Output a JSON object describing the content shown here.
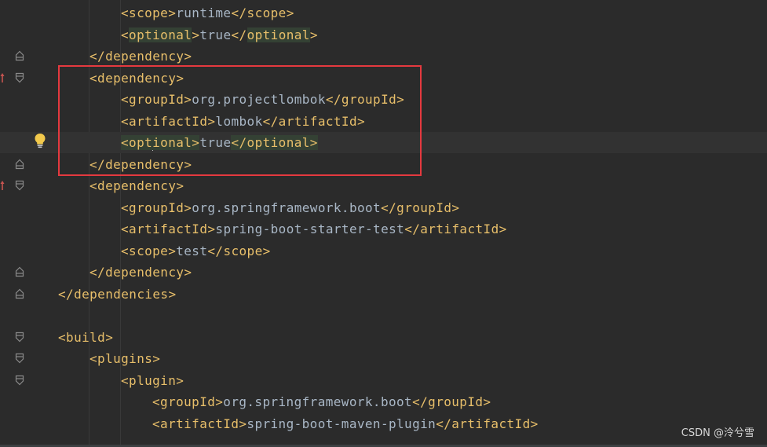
{
  "editor": {
    "lines": [
      {
        "indent": 2,
        "parts": [
          {
            "k": "tag",
            "t": "<scope>"
          },
          {
            "k": "txt",
            "t": "runtime"
          },
          {
            "k": "tag",
            "t": "</scope>"
          }
        ]
      },
      {
        "indent": 2,
        "parts": [
          {
            "k": "tag",
            "t": "<"
          },
          {
            "k": "tag-hl",
            "t": "optional"
          },
          {
            "k": "tag",
            "t": ">"
          },
          {
            "k": "txt",
            "t": "true"
          },
          {
            "k": "tag",
            "t": "</"
          },
          {
            "k": "tag-hl",
            "t": "optional"
          },
          {
            "k": "tag",
            "t": ">"
          }
        ]
      },
      {
        "indent": 1,
        "parts": [
          {
            "k": "tag",
            "t": "</dependency>"
          }
        ]
      },
      {
        "indent": 1,
        "parts": [
          {
            "k": "tag",
            "t": "<dependency>"
          }
        ]
      },
      {
        "indent": 2,
        "parts": [
          {
            "k": "tag",
            "t": "<groupId>"
          },
          {
            "k": "txt",
            "t": "org.projectlombok"
          },
          {
            "k": "tag",
            "t": "</groupId>"
          }
        ]
      },
      {
        "indent": 2,
        "parts": [
          {
            "k": "tag",
            "t": "<artifactId>"
          },
          {
            "k": "txt",
            "t": "lombok"
          },
          {
            "k": "tag",
            "t": "</artifactId>"
          }
        ]
      },
      {
        "indent": 2,
        "current": true,
        "parts": [
          {
            "k": "tag-hl",
            "t": "<opt"
          },
          {
            "k": "caret",
            "t": ""
          },
          {
            "k": "tag-hl",
            "t": "ional>"
          },
          {
            "k": "txt",
            "t": "true"
          },
          {
            "k": "tag-hl",
            "t": "</optional>"
          }
        ]
      },
      {
        "indent": 1,
        "parts": [
          {
            "k": "tag",
            "t": "</dependency>"
          }
        ]
      },
      {
        "indent": 1,
        "parts": [
          {
            "k": "tag",
            "t": "<dependency>"
          }
        ]
      },
      {
        "indent": 2,
        "parts": [
          {
            "k": "tag",
            "t": "<groupId>"
          },
          {
            "k": "txt",
            "t": "org.springframework.boot"
          },
          {
            "k": "tag",
            "t": "</groupId>"
          }
        ]
      },
      {
        "indent": 2,
        "parts": [
          {
            "k": "tag",
            "t": "<artifactId>"
          },
          {
            "k": "txt",
            "t": "spring-boot-starter-test"
          },
          {
            "k": "tag",
            "t": "</artifactId>"
          }
        ]
      },
      {
        "indent": 2,
        "parts": [
          {
            "k": "tag",
            "t": "<scope>"
          },
          {
            "k": "txt",
            "t": "test"
          },
          {
            "k": "tag",
            "t": "</scope>"
          }
        ]
      },
      {
        "indent": 1,
        "parts": [
          {
            "k": "tag",
            "t": "</dependency>"
          }
        ]
      },
      {
        "indent": 0,
        "parts": [
          {
            "k": "tag",
            "t": "</dependencies>"
          }
        ]
      },
      {
        "indent": 0,
        "parts": []
      },
      {
        "indent": 0,
        "parts": [
          {
            "k": "tag",
            "t": "<build>"
          }
        ]
      },
      {
        "indent": 1,
        "parts": [
          {
            "k": "tag",
            "t": "<plugins>"
          }
        ]
      },
      {
        "indent": 2,
        "parts": [
          {
            "k": "tag",
            "t": "<plugin>"
          }
        ]
      },
      {
        "indent": 3,
        "parts": [
          {
            "k": "tag",
            "t": "<groupId>"
          },
          {
            "k": "txt",
            "t": "org.springframework.boot"
          },
          {
            "k": "tag",
            "t": "</groupId>"
          }
        ]
      },
      {
        "indent": 3,
        "parts": [
          {
            "k": "tag",
            "t": "<artifactId>"
          },
          {
            "k": "txt",
            "t": "spring-boot-maven-plugin"
          },
          {
            "k": "tag",
            "t": "</artifactId>"
          }
        ]
      }
    ],
    "gutter": [
      {
        "line": 2,
        "icon": "fold-end-icon"
      },
      {
        "line": 3,
        "icon": "fold-start-icon",
        "arrow": true
      },
      {
        "line": 6,
        "icon": "intention-bulb-icon"
      },
      {
        "line": 7,
        "icon": "fold-end-icon"
      },
      {
        "line": 8,
        "icon": "fold-start-icon",
        "arrow": true
      },
      {
        "line": 12,
        "icon": "fold-end-icon"
      },
      {
        "line": 13,
        "icon": "fold-end-icon"
      },
      {
        "line": 15,
        "icon": "fold-start-icon"
      },
      {
        "line": 16,
        "icon": "fold-start-icon"
      },
      {
        "line": 17,
        "icon": "fold-start-icon"
      }
    ]
  },
  "watermark": "CSDN @泠兮雪",
  "colors": {
    "background": "#2b2b2b",
    "tag": "#e8bf6a",
    "text": "#a9b7c6",
    "match_highlight": "#344134",
    "annotation_box": "#e5393f",
    "gutter_arrow": "#c75450"
  }
}
